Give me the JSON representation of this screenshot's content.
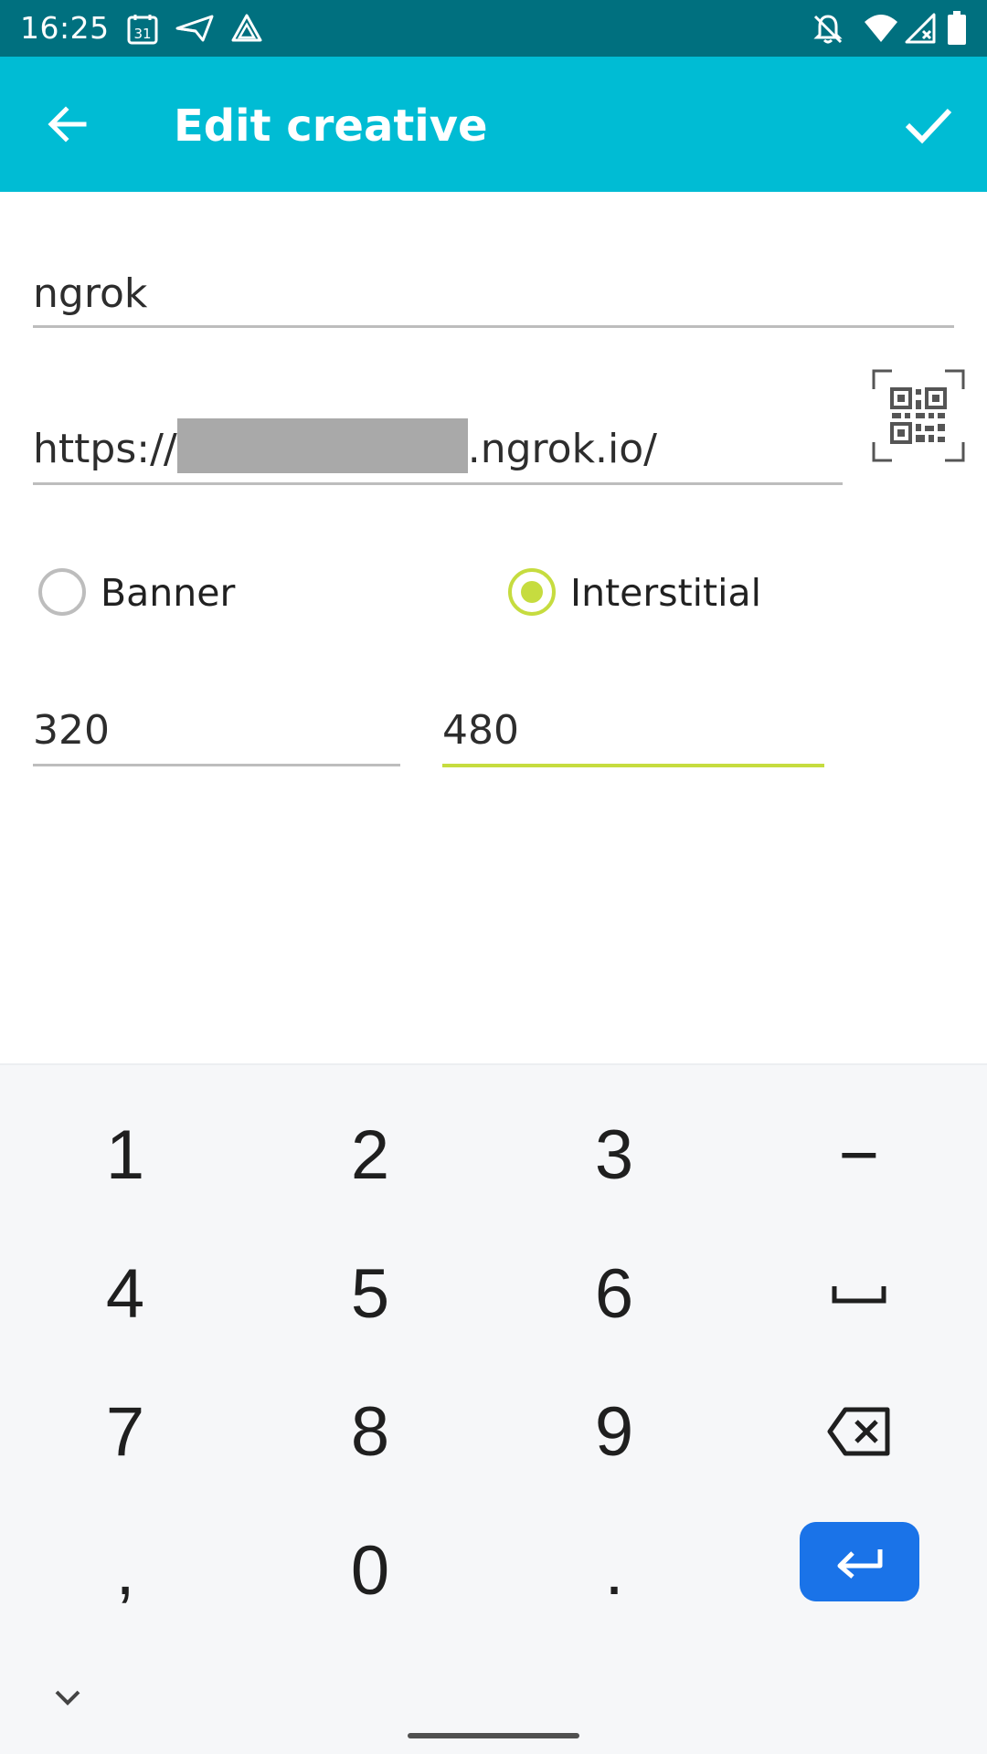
{
  "status_bar": {
    "time": "16:25",
    "calendar_badge": "31",
    "left_icons": [
      "calendar-icon",
      "send-icon",
      "drive-icon"
    ],
    "right_icons": [
      "notifications-off-icon",
      "wifi-icon",
      "cell-signal-icon",
      "battery-icon"
    ]
  },
  "app_bar": {
    "title": "Edit creative",
    "back_icon": "arrow-back-icon",
    "confirm_icon": "check-icon",
    "color": "#00bcd4"
  },
  "form": {
    "name_value": "ngrok",
    "url_prefix": "https://",
    "url_suffix": ".ngrok.io/",
    "qr_icon": "qr-scan-icon",
    "format_options": [
      {
        "label": "Banner",
        "checked": false
      },
      {
        "label": "Interstitial",
        "checked": true
      }
    ],
    "width_value": "320",
    "height_value": "480",
    "accent_color": "#c6dc3f"
  },
  "keyboard": {
    "rows": [
      [
        "1",
        "2",
        "3",
        "−"
      ],
      [
        "4",
        "5",
        "6",
        "space"
      ],
      [
        "7",
        "8",
        "9",
        "backspace"
      ],
      [
        ",",
        "0",
        ".",
        "enter"
      ]
    ],
    "enter_color": "#1a73e8",
    "hide_icon": "chevron-down-icon"
  }
}
